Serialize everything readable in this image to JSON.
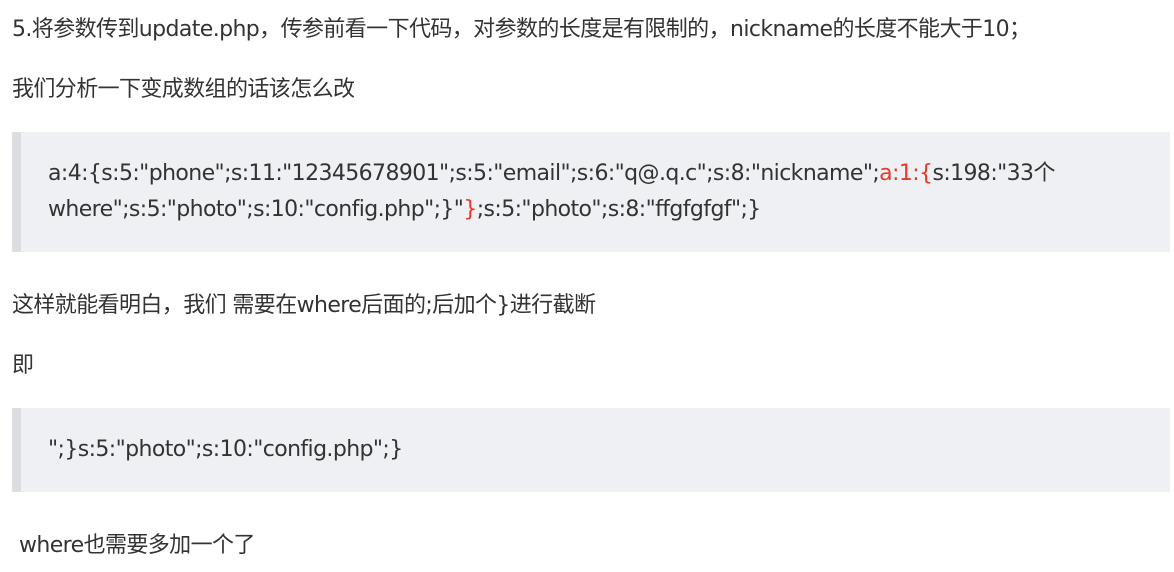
{
  "paragraphs": {
    "p1": "5.将参数传到update.php，传参前看一下代码，对参数的长度是有限制的，nickname的长度不能大于10；",
    "p2": "我们分析一下变成数组的话该怎么改",
    "p3": "这样就能看明白，我们 需要在where后面的;后加个}进行截断",
    "p4": "即",
    "p5": "where也需要多加一个了"
  },
  "quote1": {
    "line1_before": "a:4:{s:5:\"phone\";s:11:\"12345678901\";s:5:\"email\";s:6:\"q@.q.c\";s:8:\"nickname\";",
    "line1_red": "a:1:{",
    "line1_after": "s:198:\"33个",
    "line2_before": "where\";s:5:\"photo\";s:10:\"config.php\";}\"",
    "line2_red": "}",
    "line2_after": ";s:5:\"photo\";s:8:\"ffgfgfgf\";}"
  },
  "quote2": {
    "line1": "\";}s:5:\"photo\";s:10:\"config.php\";}"
  },
  "colors": {
    "text": "#333333",
    "highlight": "#e83a2c",
    "quote_background": "#eff0f3",
    "quote_border": "#dcdde1"
  }
}
